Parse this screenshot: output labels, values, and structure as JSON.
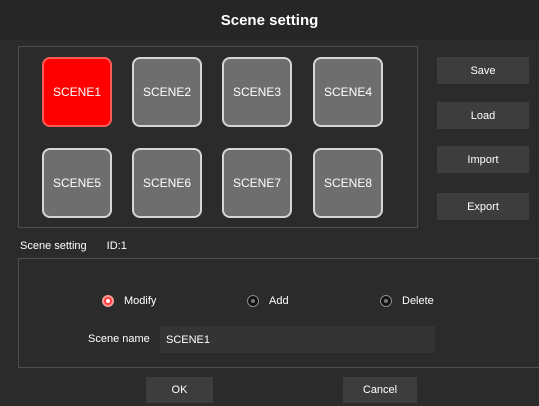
{
  "dialog": {
    "title": "Scene setting"
  },
  "scenes": [
    {
      "label": "SCENE1",
      "active": true
    },
    {
      "label": "SCENE2",
      "active": false
    },
    {
      "label": "SCENE3",
      "active": false
    },
    {
      "label": "SCENE4",
      "active": false
    },
    {
      "label": "SCENE5",
      "active": false
    },
    {
      "label": "SCENE6",
      "active": false
    },
    {
      "label": "SCENE7",
      "active": false
    },
    {
      "label": "SCENE8",
      "active": false
    }
  ],
  "actions": {
    "save": "Save",
    "load": "Load",
    "import": "Import",
    "export": "Export"
  },
  "section": {
    "label": "Scene setting",
    "id": "ID:1"
  },
  "modes": [
    {
      "label": "Modify",
      "selected": true
    },
    {
      "label": "Add",
      "selected": false
    },
    {
      "label": "Delete",
      "selected": false
    }
  ],
  "scene_name": {
    "label": "Scene name",
    "value": "SCENE1"
  },
  "footer": {
    "ok": "OK",
    "cancel": "Cancel"
  },
  "colors": {
    "active_scene": "#ff0000",
    "background": "#2b2b2b",
    "button": "#3d3d3d"
  }
}
